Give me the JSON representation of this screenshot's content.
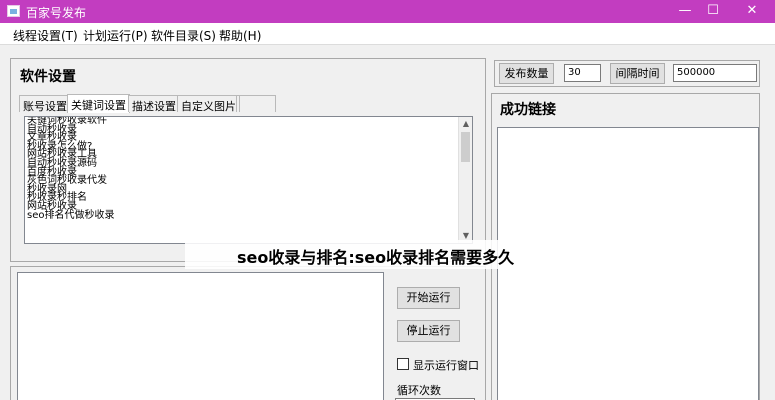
{
  "window": {
    "title": "百家号发布",
    "minimize": "—",
    "maximize": "☐",
    "close": "✕",
    "accent_color": "#c23dc0"
  },
  "menu": [
    "线程设置(T)",
    "计划运行(P)",
    "软件目录(S)",
    "帮助(H)"
  ],
  "settings_panel": {
    "title": "软件设置",
    "tabs": [
      "账号设置",
      "关键词设置",
      "描述设置",
      "自定义图片"
    ],
    "active_tab": "关键词设置",
    "keywords": [
      "关键词秒收录软件",
      "自动秒收录",
      "文章秒收录",
      "秒收录怎么做?",
      "网站秒收录工具",
      "自动秒收录源码",
      "百度秒收录",
      "灰色词秒收录代发",
      "秒收录网",
      "秒收录秒排名",
      "网站秒收录",
      "seo排名代做秒收录"
    ]
  },
  "run_panel": {
    "start_button": "开始运行",
    "stop_button": "停止运行",
    "show_window_label": "显示运行窗口",
    "show_window_checked": false,
    "loop_count_label": "循环次数"
  },
  "top_controls": {
    "publish_count_button": "发布数量",
    "publish_count_value": "30",
    "interval_button": "间隔时间",
    "interval_value": "500000"
  },
  "result_panel": {
    "title": "成功链接"
  },
  "watermark": "seo收录与排名:seo收录排名需要多久"
}
